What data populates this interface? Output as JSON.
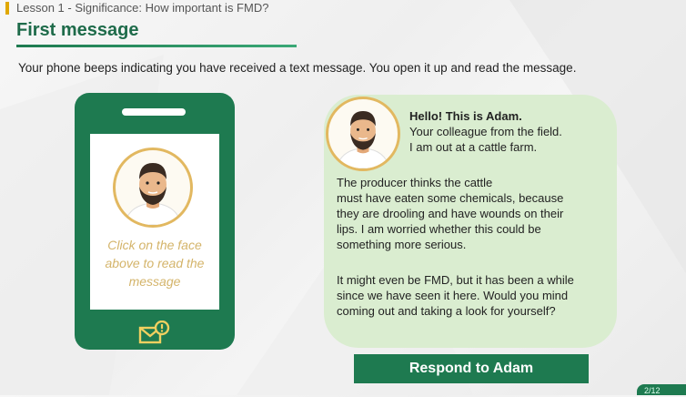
{
  "header": {
    "lesson": "Lesson 1 - Significance: How important is FMD?",
    "title": "First message"
  },
  "intro": "Your phone beeps indicating you have received a text message. You open it up and read the message.",
  "phone": {
    "hint": "Click on the face\nabove to read the\nmessage",
    "icon": "mail-notification-icon"
  },
  "message": {
    "greeting": "Hello! This is Adam.",
    "line1": "Your colleague from the field.",
    "line2": "I am out at a cattle farm.",
    "para1": "The  producer thinks the cattle\nmust have eaten some chemicals, because\nthey are drooling and have wounds on their\nlips. I am worried whether this could be\nsomething more serious.",
    "para2": "It might even be FMD, but it has been a while\nsince we have seen it here. Would you mind\ncoming out and taking a look for yourself?"
  },
  "respond_button": "Respond to Adam",
  "page_indicator": "2/12",
  "colors": {
    "brand_green": "#1e7a50",
    "gold": "#e2b860",
    "bubble": "#daedd0",
    "hint": "#d4b46a"
  }
}
